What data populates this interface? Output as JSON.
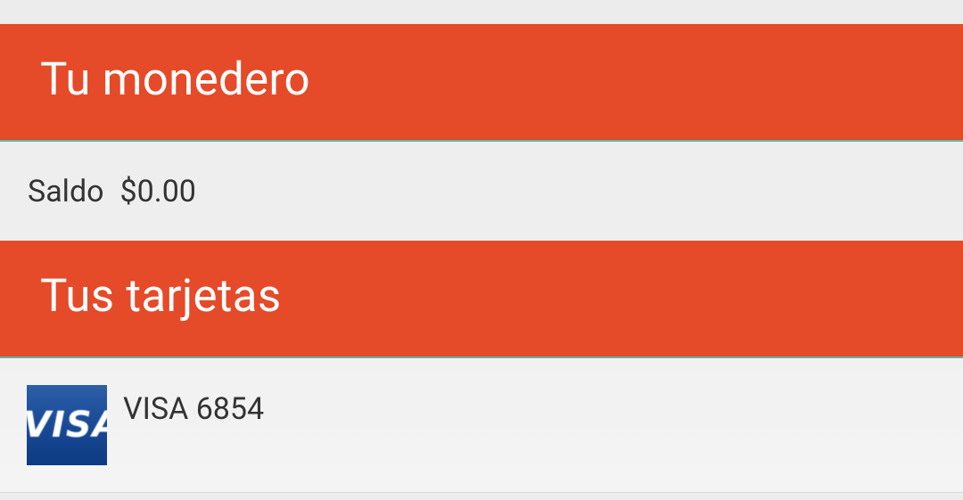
{
  "wallet_section": {
    "title": "Tu monedero",
    "balance_label": "Saldo",
    "balance_value": "$0.00"
  },
  "cards_section": {
    "title": "Tus tarjetas",
    "cards": [
      {
        "brand_logo_text": "VISA",
        "label": "VISA 6854"
      }
    ]
  },
  "colors": {
    "header_background": "#e54a29",
    "header_text": "#ffffff",
    "divider_accent": "#5fb6a6",
    "visa_blue": "#1a4b97"
  }
}
